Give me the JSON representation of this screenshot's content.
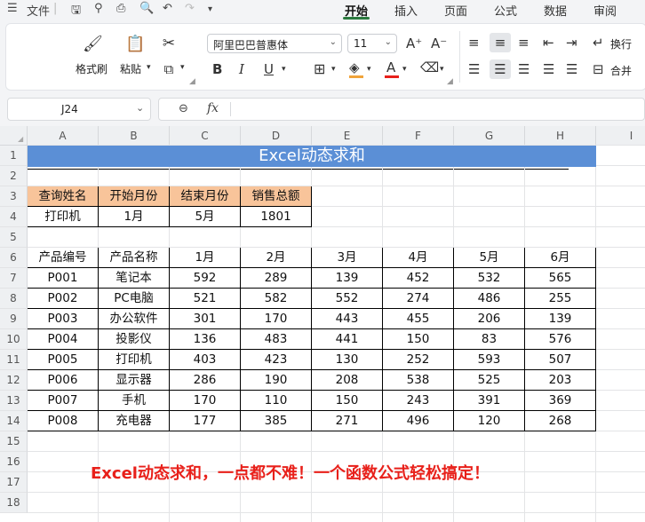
{
  "menu": {
    "file_label": "文件",
    "tabs": [
      {
        "label": "开始",
        "active": true
      },
      {
        "label": "插入",
        "active": false
      },
      {
        "label": "页面",
        "active": false
      },
      {
        "label": "公式",
        "active": false
      },
      {
        "label": "数据",
        "active": false
      },
      {
        "label": "审阅",
        "active": false
      }
    ]
  },
  "ribbon": {
    "format_painter": "格式刷",
    "paste": "粘贴",
    "font_name": "阿里巴巴普惠体",
    "font_size": "11",
    "wrap": "换行",
    "merge": "合并"
  },
  "formula_bar": {
    "name_box": "J24",
    "fx_label": "fx",
    "formula": ""
  },
  "columns": [
    "A",
    "B",
    "C",
    "D",
    "E",
    "F",
    "G",
    "H",
    "I"
  ],
  "rows": [
    "1",
    "2",
    "3",
    "4",
    "5",
    "6",
    "7",
    "8",
    "9",
    "10",
    "11",
    "12",
    "13",
    "14",
    "15",
    "16",
    "17",
    "18"
  ],
  "sheet": {
    "title": "Excel动态求和",
    "query": {
      "headers": [
        "查询姓名",
        "开始月份",
        "结束月份",
        "销售总额"
      ],
      "values": [
        "打印机",
        "1月",
        "5月",
        "1801"
      ]
    },
    "table": {
      "headers": [
        "产品编号",
        "产品名称",
        "1月",
        "2月",
        "3月",
        "4月",
        "5月",
        "6月"
      ],
      "rows": [
        [
          "P001",
          "笔记本",
          "592",
          "289",
          "139",
          "452",
          "532",
          "565"
        ],
        [
          "P002",
          "PC电脑",
          "521",
          "582",
          "552",
          "274",
          "486",
          "255"
        ],
        [
          "P003",
          "办公软件",
          "301",
          "170",
          "443",
          "455",
          "206",
          "139"
        ],
        [
          "P004",
          "投影仪",
          "136",
          "483",
          "441",
          "150",
          "83",
          "576"
        ],
        [
          "P005",
          "打印机",
          "403",
          "423",
          "130",
          "252",
          "593",
          "507"
        ],
        [
          "P006",
          "显示器",
          "286",
          "190",
          "208",
          "538",
          "525",
          "203"
        ],
        [
          "P007",
          "手机",
          "170",
          "110",
          "150",
          "243",
          "391",
          "369"
        ],
        [
          "P008",
          "充电器",
          "177",
          "385",
          "271",
          "496",
          "120",
          "268"
        ]
      ]
    },
    "note": "Excel动态求和，一点都不难！一个函数公式轻松搞定！"
  },
  "colors": {
    "title_band": "#5b8fd6",
    "query_header": "#f8c49a",
    "note": "#e8201a",
    "active_tab": "#2b7a3f"
  }
}
